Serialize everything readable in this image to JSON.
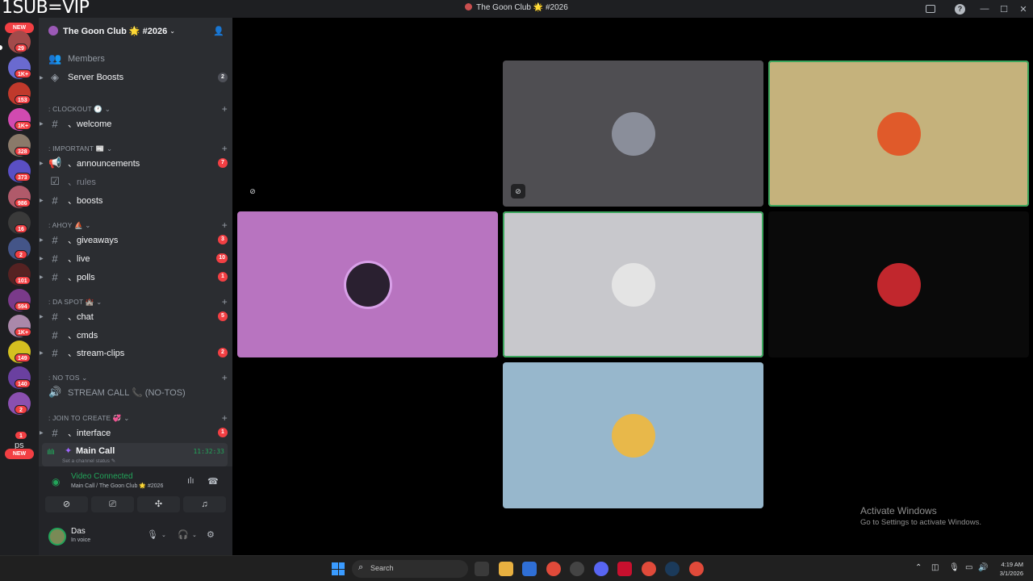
{
  "overlay_text": "1SUB=VIP",
  "window": {
    "title": "The Goon Club 🌟 #2026"
  },
  "server_rail": {
    "new_label": "NEW",
    "badges": [
      "29",
      "1K+",
      "153",
      "1K+",
      "328",
      "373",
      "986",
      "16",
      "2",
      "101",
      "594",
      "1K+",
      "149",
      "140",
      "2",
      "1"
    ],
    "ps_label": "ps"
  },
  "sidebar": {
    "server_name": "The Goon Club 🌟 #2026",
    "top_items": [
      {
        "label": "Members"
      },
      {
        "label": "Server Boosts",
        "count": "2"
      }
    ],
    "categories": [
      {
        "name": ": CLOCKOUT 🕐"
      },
      {
        "name": ": IMPORTANT 📰"
      },
      {
        "name": ": AHOY ⛵"
      },
      {
        "name": ": DA SPOT 🏰"
      },
      {
        "name": ": NO TOS"
      },
      {
        "name": ": JOIN TO CREATE 💞"
      }
    ],
    "channels": [
      {
        "label": "、welcome"
      },
      {
        "label": "、announcements",
        "count": "7"
      },
      {
        "label": "、rules"
      },
      {
        "label": "、boosts"
      },
      {
        "label": "、giveaways",
        "count": "3"
      },
      {
        "label": "、live",
        "count": "10"
      },
      {
        "label": "、polls",
        "count": "1"
      },
      {
        "label": "、chat",
        "count": "5"
      },
      {
        "label": "、cmds"
      },
      {
        "label": "、stream-clips",
        "count": "2"
      },
      {
        "label": "STREAM CALL 📞 (NO-TOS)"
      },
      {
        "label": "、interface",
        "count": "1"
      }
    ],
    "voice_channel": {
      "name": "Main Call",
      "status": "Set a channel status ✎",
      "timer": "11:32:33"
    }
  },
  "voice_panel": {
    "title": "Video Connected",
    "subtitle": "Main Call / The Goon Club 🌟 #2026"
  },
  "user": {
    "name": "Das",
    "status": "In voice"
  },
  "watermark": {
    "title": "Activate Windows",
    "subtitle": "Go to Settings to activate Windows."
  },
  "taskbar": {
    "search_placeholder": "Search",
    "time": "4:19 AM",
    "date": "3/1/2026"
  },
  "tiles": [
    {
      "bg": "#000000",
      "avatar": "none",
      "muted": true
    },
    {
      "bg": "#4f4e52",
      "avatar": "#8a8e9a",
      "muted": true
    },
    {
      "bg": "#c5b27c",
      "avatar": "#e05a2a",
      "speaking": true
    },
    {
      "bg": "#b874c0",
      "avatar": "#2a2030"
    },
    {
      "bg": "#c8c8cc",
      "avatar": "#e4e4e4",
      "speaking": true
    },
    {
      "bg": "#0a0a0a",
      "avatar": "#c1272d"
    },
    {
      "bg": "#97b7cc",
      "avatar": "#e8b84a"
    }
  ],
  "colors": {
    "accent_green": "#23a55a",
    "notify_red": "#f23f43",
    "sidebar_bg": "#2b2d31",
    "rail_bg": "#1e1f22"
  }
}
